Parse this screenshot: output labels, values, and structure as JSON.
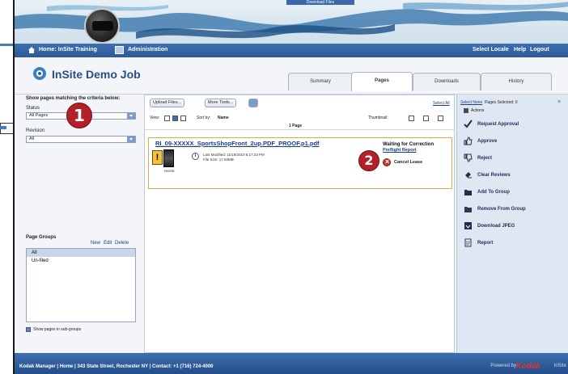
{
  "app": {
    "download_label": "Download Files",
    "nav": {
      "home_label": "Home: InSite Training",
      "admin_label": "Administration",
      "select_locale": "Select Locale",
      "help": "Help",
      "logout": "Logout"
    },
    "title": "InSite Demo Job",
    "tabs": [
      {
        "label": "Summary"
      },
      {
        "label": "Pages"
      },
      {
        "label": "Downloads"
      },
      {
        "label": "History"
      }
    ]
  },
  "filters": {
    "instruction": "Show pages matching the criteria below:",
    "status_label": "Status",
    "status_value": "All Pages",
    "revision_label": "Revision",
    "revision_value": "All",
    "page_groups_label": "Page Groups",
    "new": "New",
    "edit": "Edit",
    "delete": "Delete",
    "groups": [
      "All",
      "Un-filed"
    ],
    "show_in_all": "Show pages in sub-groups"
  },
  "center": {
    "upload_btn": "Upload Files...",
    "more_tools_btn": "More Tools...",
    "select_all": "Select All",
    "select_none": "Select None",
    "pages_selected": "Pages Selected: 0",
    "view_label": "View:",
    "sort_label": "Sort by:",
    "sort_value": "Name",
    "thumbnail_label": "Thumbnail:",
    "page_count": "1 Page",
    "job_file": "RI_09-XXXXX_SportsShopFront_2up.PDF_PROOF.p1.pdf",
    "thumb_caption": "recent",
    "meta_line1": "Last Modified: 11/18/2010 6:17:23 PM",
    "meta_line2": "File Size: 17.93MB",
    "waiting": "Waiting for Correction",
    "preview_report": "Preflight Report",
    "cancel_label": "Cancel Lease"
  },
  "callouts": [
    "1",
    "2"
  ],
  "actions": {
    "header": "Actions",
    "items": [
      {
        "label": "Request Approval",
        "icon": "checkmark-icon"
      },
      {
        "label": "Approve",
        "icon": "thumbs-up-icon"
      },
      {
        "label": "Reject",
        "icon": "thumbs-down-icon"
      },
      {
        "label": "Clear Reviews",
        "icon": "clear-icon"
      },
      {
        "label": "Add To Group",
        "icon": "folder-add-icon"
      },
      {
        "label": "Remove From Group",
        "icon": "folder-remove-icon"
      },
      {
        "label": "Download JPEG",
        "icon": "download-jpeg-icon"
      },
      {
        "label": "Report",
        "icon": "report-icon"
      }
    ]
  },
  "footer": {
    "text": "Kodak Manager | Home | 343 State Street, Rochester NY | Contact: +1 (716) 724-4000",
    "brand_prefix": "Powered by",
    "brand": "Kodak",
    "brand_suffix": "InSite"
  },
  "colors": {
    "nav_blue": "#2d5a98",
    "link_blue": "#1a3d8a",
    "callout_red": "#b3202a",
    "warning_yellow": "#f1c33a",
    "actions_bg": "#dfe7f2"
  }
}
